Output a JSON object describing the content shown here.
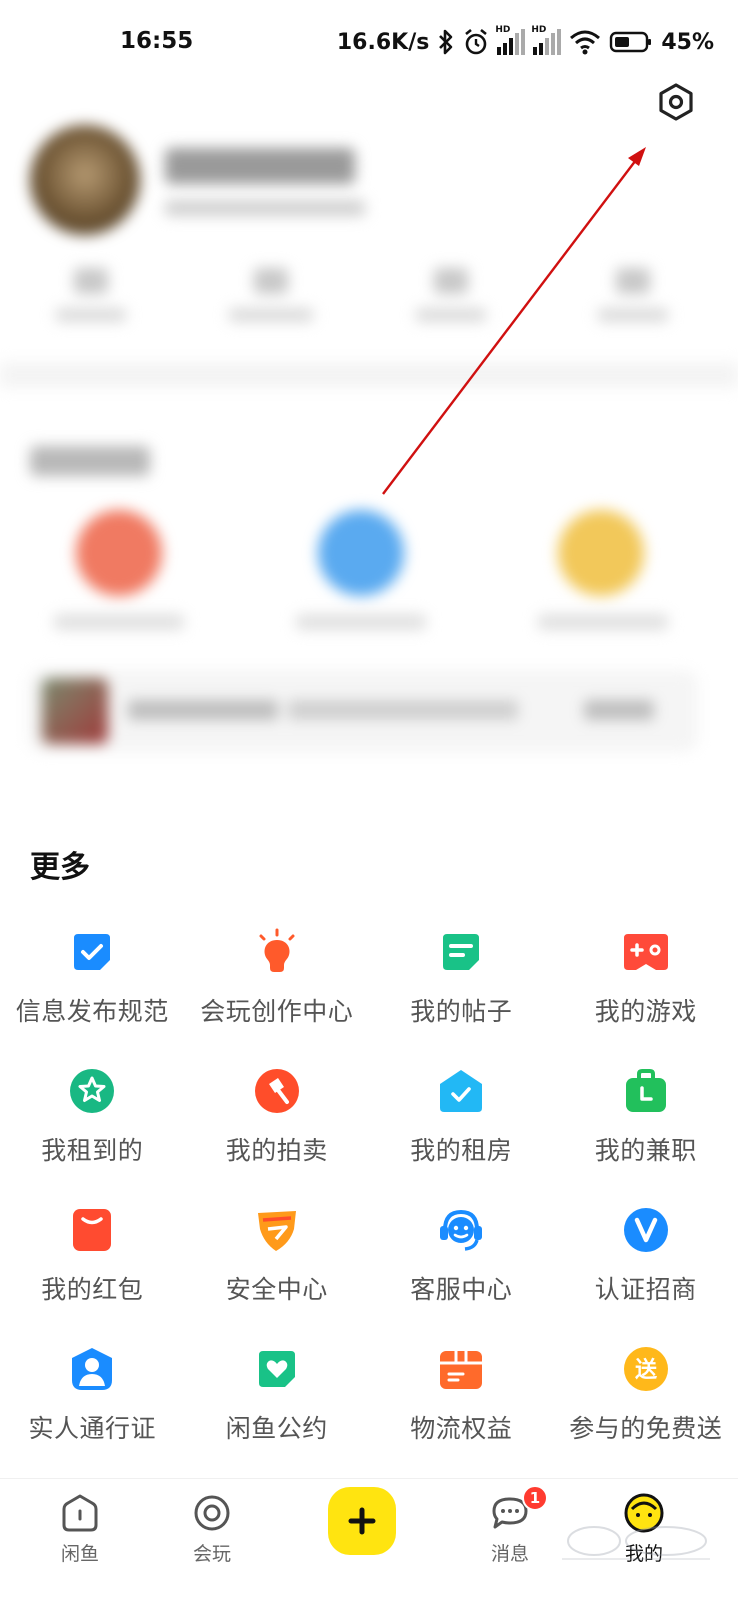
{
  "status_bar": {
    "time": "16:55",
    "net_speed": "16.6K/s",
    "battery": "45%"
  },
  "more_section": {
    "title": "更多",
    "items": [
      {
        "label": "信息发布规范",
        "icon": "check-square-icon",
        "color": "#1a8cff"
      },
      {
        "label": "会玩创作中心",
        "icon": "lightbulb-icon",
        "color": "#ff5a2b"
      },
      {
        "label": "我的帖子",
        "icon": "post-icon",
        "color": "#19c287"
      },
      {
        "label": "我的游戏",
        "icon": "gamepad-icon",
        "color": "#ff4a3a"
      },
      {
        "label": "我租到的",
        "icon": "star-badge-icon",
        "color": "#19b883"
      },
      {
        "label": "我的拍卖",
        "icon": "gavel-icon",
        "color": "#ff4d2a"
      },
      {
        "label": "我的租房",
        "icon": "house-icon",
        "color": "#22b8f5"
      },
      {
        "label": "我的兼职",
        "icon": "briefcase-icon",
        "color": "#22c05c"
      },
      {
        "label": "我的红包",
        "icon": "red-packet-icon",
        "color": "#ff4b30"
      },
      {
        "label": "安全中心",
        "icon": "shield-icon",
        "color": "#ff9a1a"
      },
      {
        "label": "客服中心",
        "icon": "headset-icon",
        "color": "#1a8cff"
      },
      {
        "label": "认证招商",
        "icon": "verified-v-icon",
        "color": "#1a8cff"
      },
      {
        "label": "实人通行证",
        "icon": "person-badge-icon",
        "color": "#1a8cff"
      },
      {
        "label": "闲鱼公约",
        "icon": "heart-doc-icon",
        "color": "#19c287"
      },
      {
        "label": "物流权益",
        "icon": "package-icon",
        "color": "#ff6a2b"
      },
      {
        "label": "参与的免费送",
        "icon": "gift-send-icon",
        "color": "#ffb81a",
        "glyph": "送"
      }
    ]
  },
  "bottom_nav": {
    "items": [
      {
        "label": "闲鱼",
        "icon": "home-icon"
      },
      {
        "label": "会玩",
        "icon": "circle-target-icon"
      },
      {
        "label": "消息",
        "icon": "message-icon"
      },
      {
        "label": "我的",
        "icon": "profile-face-icon"
      }
    ],
    "message_badge": "1",
    "publish_icon": "plus-icon"
  },
  "colors": {
    "accent_yellow": "#ffe410",
    "annotation_arrow": "#d01010"
  }
}
